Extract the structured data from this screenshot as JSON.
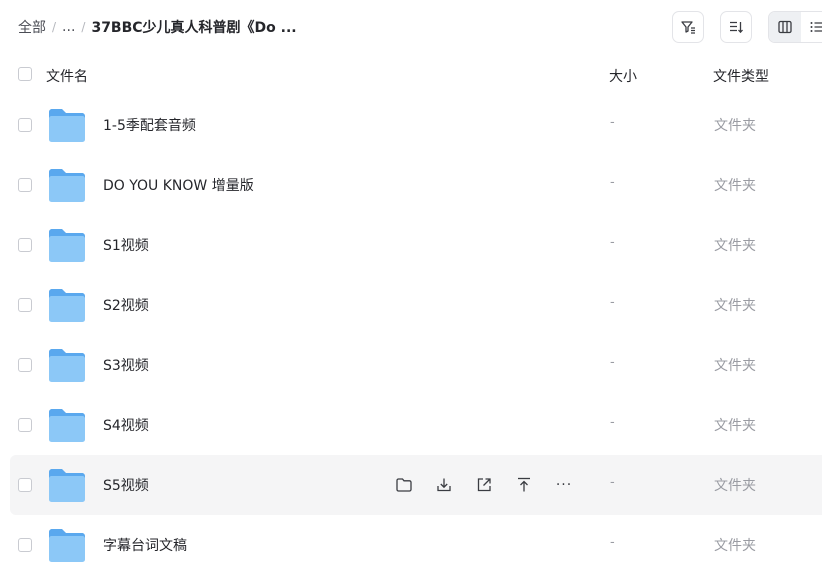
{
  "breadcrumb": {
    "root": "全部",
    "ellipsis": "...",
    "current": "37BBC少儿真人科普剧《Do ..."
  },
  "columns": {
    "name": "文件名",
    "size": "大小",
    "type": "文件类型"
  },
  "files": [
    {
      "name": "1-5季配套音频",
      "size": "-",
      "type": "文件夹"
    },
    {
      "name": "DO YOU KNOW 增量版",
      "size": "-",
      "type": "文件夹"
    },
    {
      "name": "S1视频",
      "size": "-",
      "type": "文件夹"
    },
    {
      "name": "S2视频",
      "size": "-",
      "type": "文件夹"
    },
    {
      "name": "S3视频",
      "size": "-",
      "type": "文件夹"
    },
    {
      "name": "S4视频",
      "size": "-",
      "type": "文件夹"
    },
    {
      "name": "S5视频",
      "size": "-",
      "type": "文件夹"
    },
    {
      "name": "字幕台词文稿",
      "size": "-",
      "type": "文件夹"
    }
  ],
  "hover_actions": {
    "more_label": "···"
  },
  "colors": {
    "folder_back": "#5aa8ee",
    "folder_front": "#8cc8f7",
    "accent": "#25262b"
  }
}
